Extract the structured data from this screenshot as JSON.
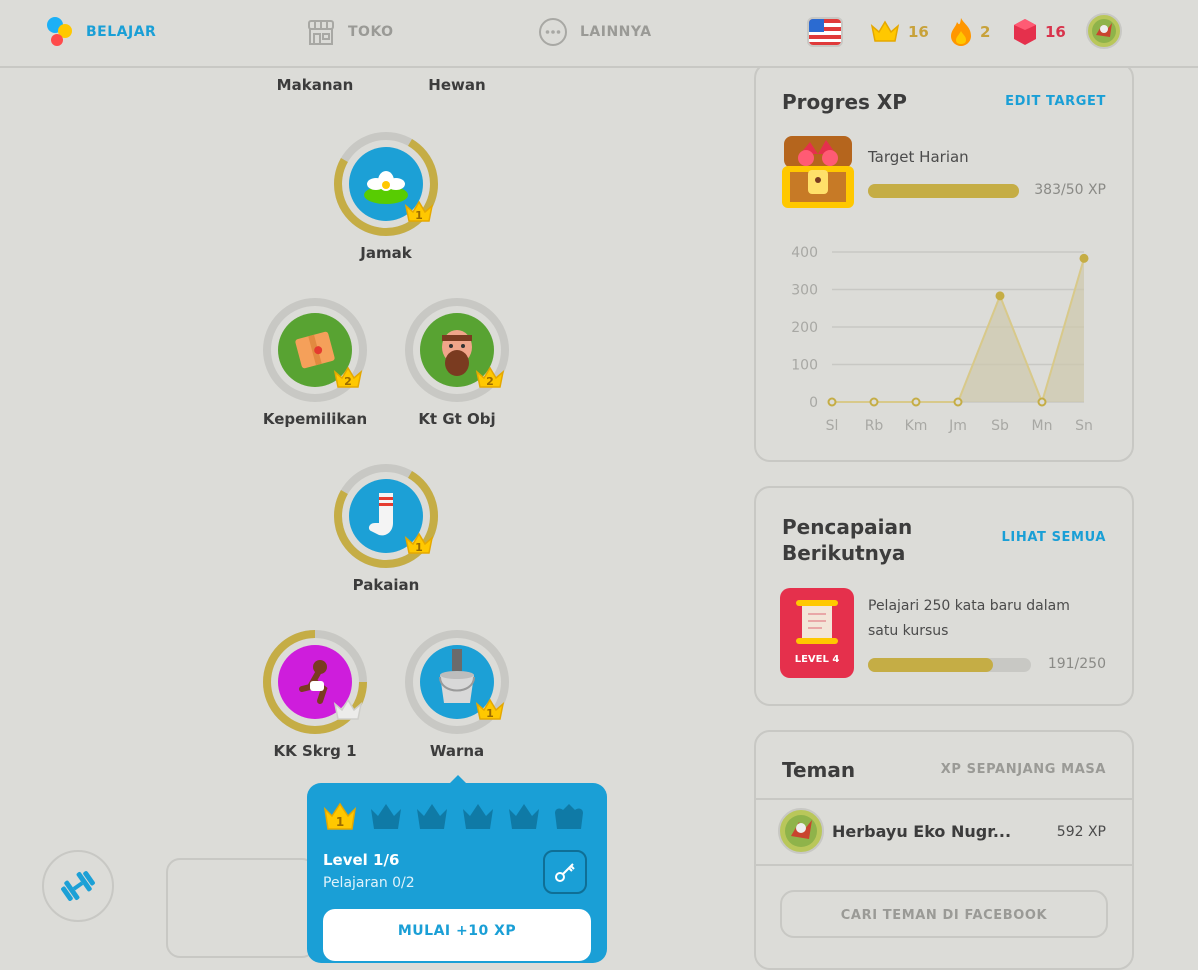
{
  "nav": {
    "learn_label": "BELAJAR",
    "shop_label": "TOKO",
    "more_label": "LAINNYA"
  },
  "stats": {
    "crowns": "16",
    "streak": "2",
    "gems": "16"
  },
  "skills": [
    {
      "name": "Makanan",
      "crown_level": "",
      "ring_fraction": 1.0
    },
    {
      "name": "Hewan",
      "crown_level": "",
      "ring_fraction": 1.0
    },
    {
      "name": "Jamak",
      "crown_level": "1",
      "ring_fraction": 0.6
    },
    {
      "name": "Kepemilikan",
      "crown_level": "2",
      "ring_fraction": 0.0
    },
    {
      "name": "Kt Gt Obj",
      "crown_level": "2",
      "ring_fraction": 0.0
    },
    {
      "name": "Pakaian",
      "crown_level": "1",
      "ring_fraction": 0.6
    },
    {
      "name": "KK Skrg 1",
      "crown_level": "",
      "ring_fraction": 0.75
    },
    {
      "name": "Warna",
      "crown_level": "1",
      "ring_fraction": 0.0
    }
  ],
  "popup": {
    "crown_level": "1",
    "level_text": "Level 1/6",
    "lessons_text": "Pelajaran 0/2",
    "start_label": "MULAI +10 XP"
  },
  "xp_card": {
    "title": "Progres XP",
    "edit_label": "EDIT TARGET",
    "daily_goal_label": "Target Harian",
    "progress_text": "383/50 XP",
    "progress_fraction": 1.0
  },
  "chart_data": {
    "type": "area",
    "categories": [
      "Sl",
      "Rb",
      "Km",
      "Jm",
      "Sb",
      "Mn",
      "Sn"
    ],
    "values": [
      0,
      0,
      0,
      0,
      283,
      0,
      383
    ],
    "yticks": [
      "0",
      "100",
      "200",
      "300",
      "400"
    ],
    "ylim": [
      0,
      400
    ],
    "grid": true,
    "colors": {
      "line": "#d8c98a",
      "point": "#c5ad45",
      "fill": "#cdc7ad"
    }
  },
  "achievement_card": {
    "title_line1": "Pencapaian",
    "title_line2": "Berikutnya",
    "view_all_label": "LIHAT SEMUA",
    "badge_level": "LEVEL 4",
    "description": "Pelajari 250 kata baru dalam satu kursus",
    "progress_text": "191/250",
    "progress_fraction": 0.764
  },
  "friends_card": {
    "title": "Teman",
    "tab_label": "XP SEPANJANG MASA",
    "friends": [
      {
        "name": "Herbayu Eko Nugr...",
        "xp": "592 XP"
      }
    ],
    "facebook_button": "CARI TEMAN DI FACEBOOK"
  },
  "colors": {
    "accent": "#1a9fd6",
    "gold": "#c5ad45",
    "background": "#dcdcd8",
    "gem": "#d8334c"
  }
}
